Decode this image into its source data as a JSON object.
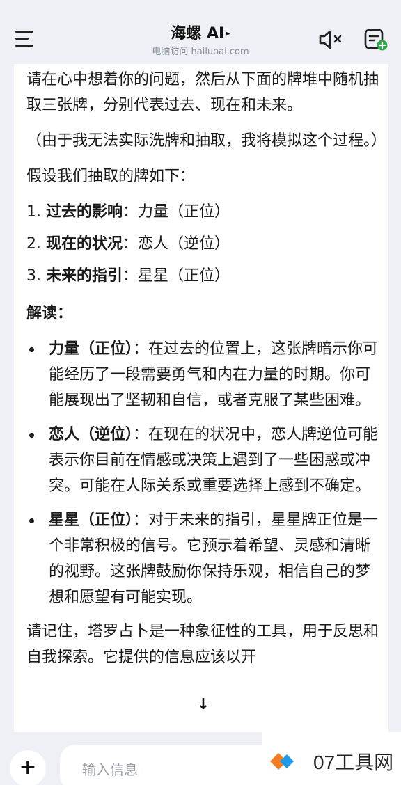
{
  "header": {
    "title": "海螺 AI",
    "title_arrow": "▸",
    "subtitle": "电脑访问 hailuoai.com",
    "icons": {
      "menu": "menu-icon",
      "mute": "speaker-mute-icon",
      "new_chat": "new-chat-icon"
    }
  },
  "message": {
    "intro": "请在心中想着你的问题，然后从下面的牌堆中随机抽取三张牌，分别代表过去、现在和未来。",
    "note": "（由于我无法实际洗牌和抽取，我将模拟这个过程。）",
    "assume": "假设我们抽取的牌如下：",
    "draws": [
      {
        "num": "1.",
        "label": "过去的影响",
        "sep": "：",
        "card": "力量（正位）"
      },
      {
        "num": "2.",
        "label": "现在的状况",
        "sep": "：",
        "card": "恋人（逆位）"
      },
      {
        "num": "3.",
        "label": "未来的指引",
        "sep": "：",
        "card": "星星（正位）"
      }
    ],
    "interpretation_heading": "解读：",
    "interpretations": [
      {
        "title": "力量（正位）",
        "sep": "：",
        "text": "在过去的位置上，这张牌暗示你可能经历了一段需要勇气和内在力量的时期。你可能展现出了坚韧和自信，或者克服了某些困难。"
      },
      {
        "title": "恋人（逆位）",
        "sep": "：",
        "text": "在现在的状况中，恋人牌逆位可能表示你目前在情感或决策上遇到了一些困惑或冲突。可能在人际关系或重要选择上感到不确定。"
      },
      {
        "title": "星星（正位）",
        "sep": "：",
        "text": "对于未来的指引，星星牌正位是一个非常积极的信号。它预示着希望、灵感和清晰的视野。这张牌鼓励你保持乐观，相信自己的梦想和愿望有可能实现。"
      }
    ],
    "closing": "请记住，塔罗占卜是一种象征性的工具，用于反思和自我探索。它提供的信息应该以开"
  },
  "scroll_button": "↓",
  "input": {
    "plus": "+",
    "placeholder": "输入信息"
  },
  "watermark": {
    "text": "07工具网"
  },
  "colors": {
    "background": "#eef0f5",
    "card": "#ffffff",
    "text": "#1a1a1a",
    "muted": "#8a8f99",
    "accent_green": "#2aa84a",
    "logo_orange": "#f57c22",
    "logo_blue": "#1e9be6"
  }
}
